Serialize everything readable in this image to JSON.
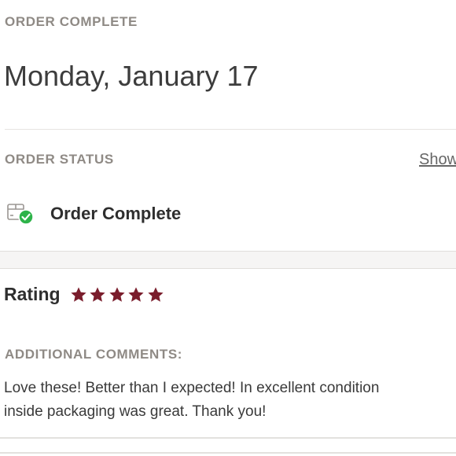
{
  "header": {
    "label": "ORDER COMPLETE",
    "date": "Monday, January 17"
  },
  "status": {
    "label": "ORDER STATUS",
    "show_link": "Show",
    "value": "Order Complete",
    "icon": "box-check-icon",
    "check_color": "#2eb34a"
  },
  "rating": {
    "label": "Rating",
    "stars": 5,
    "max_stars": 5,
    "star_color": "#7a1d2c"
  },
  "comments": {
    "label": "ADDITIONAL COMMENTS:",
    "line1": "Love these! Better than I expected! In excellent condition",
    "line2": "inside packaging was great. Thank you!"
  }
}
